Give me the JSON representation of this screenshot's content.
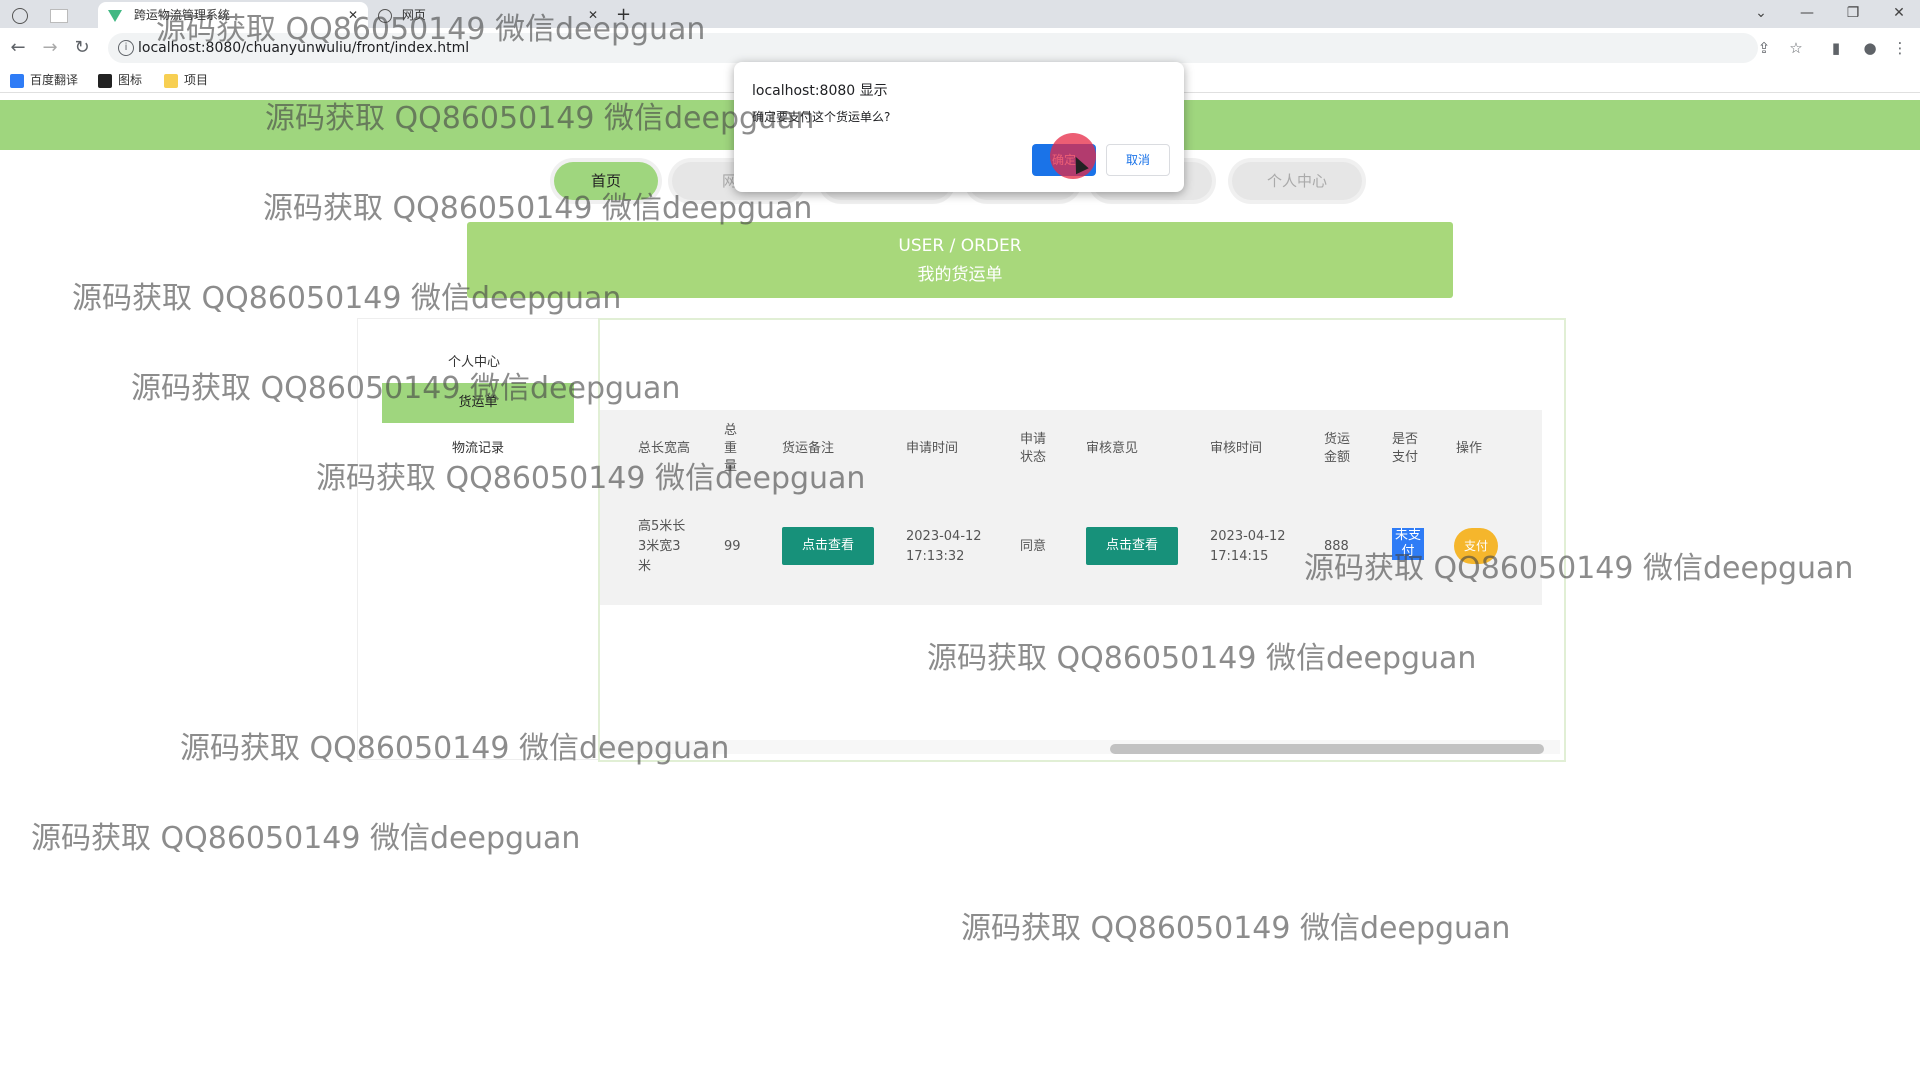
{
  "browser": {
    "tabs": [
      {
        "label": ""
      },
      {
        "label": ""
      },
      {
        "label": "跨运物流管理系统"
      },
      {
        "label": "网页"
      }
    ],
    "new_tab": "+",
    "window_controls": [
      "⌄",
      "—",
      "❐",
      "✕"
    ],
    "url": "localhost:8080/chuanyunwuliu/front/index.html",
    "bookmarks": [
      "百度翻译",
      "图标",
      "项目"
    ]
  },
  "nav": {
    "items": [
      "首页",
      "网站",
      "",
      "",
      "",
      "个人中心"
    ]
  },
  "banner": {
    "en": "USER / ORDER",
    "cn": "我的货运单"
  },
  "sidebar": {
    "title": "个人中心",
    "items": [
      "货运单",
      "物流记录"
    ]
  },
  "table": {
    "headers": {
      "size": "总长宽高",
      "weight": "总\n重\n量",
      "remark": "货运备注",
      "apply_time": "申请时间",
      "status": "申请\n状态",
      "review": "审核意见",
      "review_time": "审核时间",
      "amount": "货运\n金额",
      "paid": "是否\n支付",
      "action": "操作"
    },
    "row": {
      "size": "高5米长\n3米宽3\n米",
      "weight": "99",
      "remark_btn": "点击查看",
      "apply_time": "2023-04-12\n17:13:32",
      "status": "同意",
      "review_btn": "点击查看",
      "review_time": "2023-04-12\n17:14:15",
      "amount": "888",
      "paid": "未支\n付",
      "action_btn": "支付"
    }
  },
  "dialog": {
    "title": "localhost:8080 显示",
    "message": "确定要支付这个货运单么?",
    "ok": "确定",
    "cancel": "取消"
  },
  "watermark": "源码获取 QQ86050149 微信deepguan"
}
